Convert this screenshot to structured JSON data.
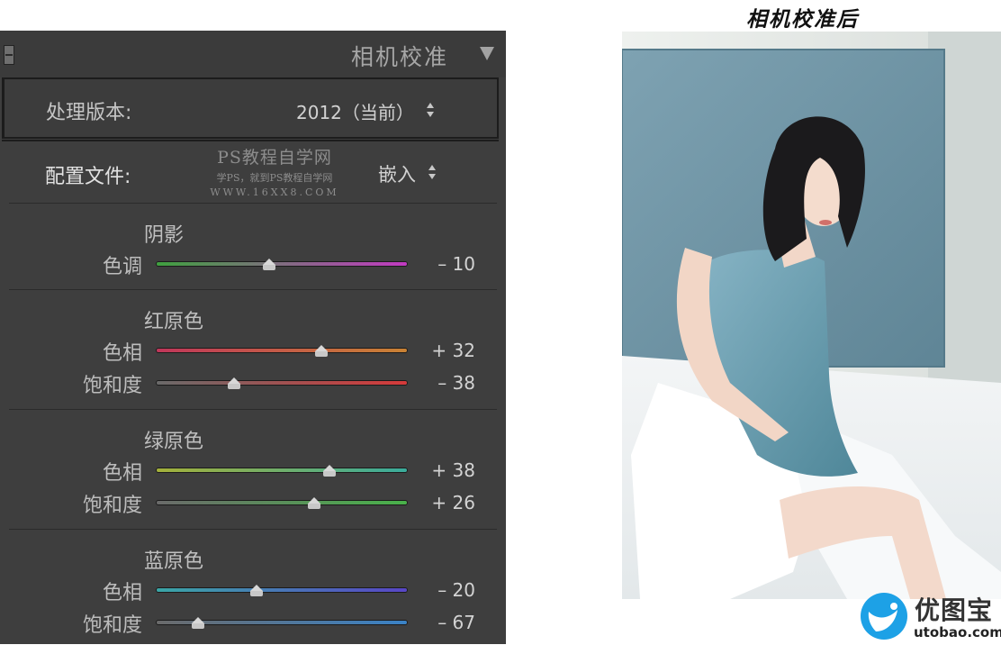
{
  "panel": {
    "title": "相机校准",
    "process": {
      "label": "处理版本:",
      "value": "2012（当前）"
    },
    "profile": {
      "label": "配置文件:",
      "value": "嵌入"
    },
    "watermark": {
      "line1": "PS教程自学网",
      "line2": "学PS，就到PS教程自学网",
      "line3": "WWW.16XX8.COM"
    },
    "groups": [
      {
        "title": "阴影",
        "sliders": [
          {
            "label": "色调",
            "value": "– 10",
            "level": -10,
            "colors": [
              "#3fa03f",
              "#c23ac2"
            ]
          }
        ]
      },
      {
        "title": "红原色",
        "sliders": [
          {
            "label": "色相",
            "value": "+ 32",
            "level": 32,
            "colors": [
              "#c0365a",
              "#c98234"
            ]
          },
          {
            "label": "饱和度",
            "value": "– 38",
            "level": -38,
            "colors": [
              "#6a6a6a",
              "#d53a3a"
            ]
          }
        ]
      },
      {
        "title": "绿原色",
        "sliders": [
          {
            "label": "色相",
            "value": "+ 38",
            "level": 38,
            "colors": [
              "#a4b03a",
              "#3aac9c"
            ]
          },
          {
            "label": "饱和度",
            "value": "+ 26",
            "level": 26,
            "colors": [
              "#6a6a6a",
              "#49b24a"
            ]
          }
        ]
      },
      {
        "title": "蓝原色",
        "sliders": [
          {
            "label": "色相",
            "value": "– 20",
            "level": -20,
            "colors": [
              "#3aa6a6",
              "#5846c6"
            ]
          },
          {
            "label": "饱和度",
            "value": "– 67",
            "level": -67,
            "colors": [
              "#6a6a6a",
              "#3a82c6"
            ]
          }
        ]
      }
    ]
  },
  "after_caption": "相机校准后",
  "logo": {
    "name": "优图宝",
    "url": "utobao.com",
    "bird_color": "#1da1e6"
  },
  "icons": {
    "panel_toggle": "square-icon",
    "collapse": "triangle-down-icon",
    "stepper": "up-down-arrows-icon"
  }
}
